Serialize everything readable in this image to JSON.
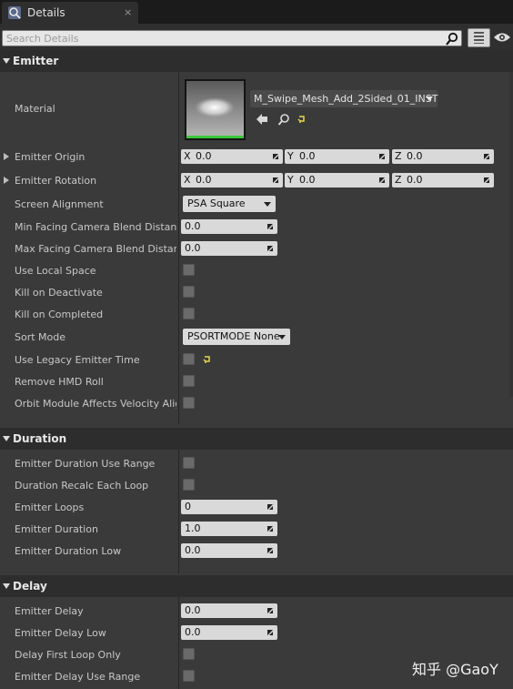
{
  "tab": {
    "title": "Details",
    "close": "×",
    "icon": "details-magnifier-icon"
  },
  "search": {
    "placeholder": "Search Details"
  },
  "categories": {
    "emitter": "Emitter",
    "duration": "Duration",
    "delay": "Delay"
  },
  "emitter": {
    "material": {
      "label": "Material",
      "value": "M_Swipe_Mesh_Add_2Sided_01_INST"
    },
    "origin": {
      "label": "Emitter Origin",
      "x_axis": "X",
      "x": "0.0",
      "y_axis": "Y",
      "y": "0.0",
      "z_axis": "Z",
      "z": "0.0"
    },
    "rotation": {
      "label": "Emitter Rotation",
      "x_axis": "X",
      "x": "0.0",
      "y_axis": "Y",
      "y": "0.0",
      "z_axis": "Z",
      "z": "0.0"
    },
    "screen_alignment": {
      "label": "Screen Alignment",
      "value": "PSA Square"
    },
    "min_facing": {
      "label": "Min Facing Camera Blend Distance",
      "value": "0.0"
    },
    "max_facing": {
      "label": "Max Facing Camera Blend Distance",
      "value": "0.0"
    },
    "use_local_space": {
      "label": "Use Local Space"
    },
    "kill_on_deactivate": {
      "label": "Kill on Deactivate"
    },
    "kill_on_completed": {
      "label": "Kill on Completed"
    },
    "sort_mode": {
      "label": "Sort Mode",
      "value": "PSORTMODE None"
    },
    "legacy_time": {
      "label": "Use Legacy Emitter Time"
    },
    "remove_hmd_roll": {
      "label": "Remove HMD Roll"
    },
    "orbit_module": {
      "label": "Orbit Module Affects Velocity Alignment"
    }
  },
  "duration": {
    "use_range": {
      "label": "Emitter Duration Use Range"
    },
    "recalc": {
      "label": "Duration Recalc Each Loop"
    },
    "loops": {
      "label": "Emitter Loops",
      "value": "0"
    },
    "duration": {
      "label": "Emitter Duration",
      "value": "1.0"
    },
    "duration_low": {
      "label": "Emitter Duration Low",
      "value": "0.0"
    }
  },
  "delay": {
    "delay": {
      "label": "Emitter Delay",
      "value": "0.0"
    },
    "delay_low": {
      "label": "Emitter Delay Low",
      "value": "0.0"
    },
    "first_loop": {
      "label": "Delay First Loop Only"
    },
    "use_range": {
      "label": "Emitter Delay Use Range"
    }
  },
  "watermark": "知乎 @GaoY",
  "colors": {
    "background": "#3a3a3a",
    "category": "#2d2d2d",
    "field": "#d9d9d9",
    "checkbox": "#6a6a6a",
    "reset_arrow": "#e8d84a",
    "thumbnail_underline": "#3cc83c"
  }
}
